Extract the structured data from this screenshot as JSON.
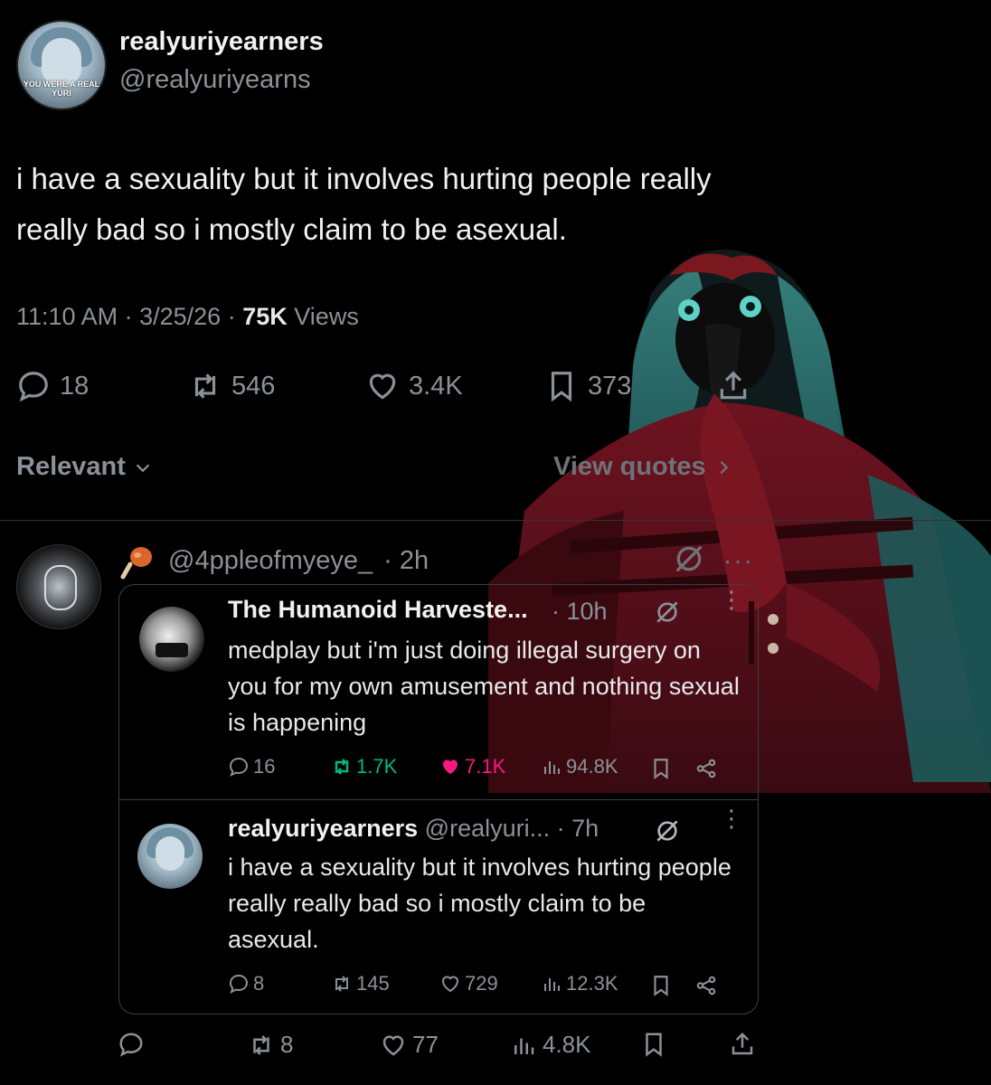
{
  "author": {
    "display_name": "realyuriyearners",
    "handle": "@realyuriyearns",
    "avatar_caption": "YOU WERE A REAL YURI"
  },
  "post": {
    "text": "i have a sexuality but it involves hurting people really really bad so i mostly claim to be asexual.",
    "time": "11:10 AM",
    "sep1": "·",
    "date": "3/25/26",
    "sep2": "·",
    "views_count": "75K",
    "views_label": "Views"
  },
  "actions": {
    "replies": "18",
    "reposts": "546",
    "likes": "3.4K",
    "bookmarks": "373"
  },
  "sort": {
    "label": "Relevant"
  },
  "view_quotes": {
    "label": "View quotes"
  },
  "reply": {
    "handle": "@4ppleofmyeye_",
    "time": "· 2h",
    "more": "···",
    "stats": {
      "replies": "",
      "reposts": "8",
      "likes": "77",
      "views": "4.8K"
    }
  },
  "quote1": {
    "name": "The Humanoid Harveste...",
    "time": "· 10h",
    "text": "medplay but i'm just doing illegal surgery on you for my own amusement and nothing sexual is happening",
    "stats": {
      "replies": "16",
      "reposts": "1.7K",
      "likes": "7.1K",
      "views": "94.8K"
    }
  },
  "quote2": {
    "name": "realyuriyearners",
    "handle": "@realyuri...",
    "time": "· 7h",
    "text": "i have a sexuality but it involves hurting people really really bad so i mostly claim to be asexual.",
    "stats": {
      "replies": "8",
      "reposts": "145",
      "likes": "729",
      "views": "12.3K"
    }
  },
  "colors": {
    "background": "#000000",
    "text": "#e7e9ea",
    "muted": "#8b9198",
    "repost_green": "#00ba7c",
    "like_pink": "#f91880"
  }
}
